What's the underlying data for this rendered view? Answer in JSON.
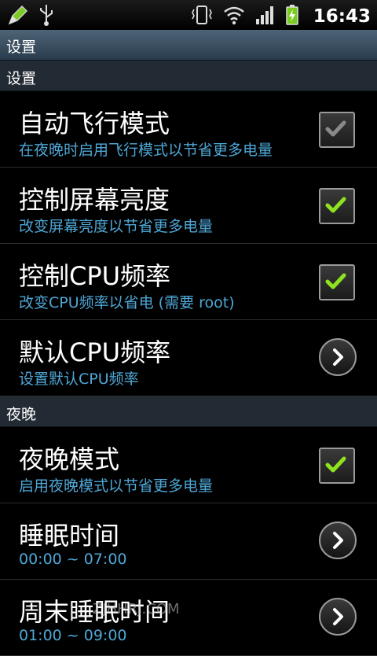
{
  "status_bar": {
    "time": "16:43",
    "icons": [
      "edit-icon",
      "usb-icon",
      "vibrate-icon",
      "wifi-icon",
      "signal-icon",
      "battery-charging-icon"
    ]
  },
  "title_bar": {
    "title": "设置"
  },
  "sections": [
    {
      "header": "设置",
      "items": [
        {
          "title": "自动飞行模式",
          "summary": "在夜晚时启用飞行模式以节省更多电量",
          "control": "checkbox",
          "checked": true,
          "enabled": false
        },
        {
          "title": "控制屏幕亮度",
          "summary": "改变屏幕亮度以节省更多电量",
          "control": "checkbox",
          "checked": true,
          "enabled": true
        },
        {
          "title": "控制CPU频率",
          "summary": "改变CPU频率以省电 (需要 root)",
          "control": "checkbox",
          "checked": true,
          "enabled": true
        },
        {
          "title": "默认CPU频率",
          "summary": "设置默认CPU频率",
          "control": "arrow"
        }
      ]
    },
    {
      "header": "夜晚",
      "items": [
        {
          "title": "夜晚模式",
          "summary": "启用夜晚模式以节省更多电量",
          "control": "checkbox",
          "checked": true,
          "enabled": true
        },
        {
          "title": "睡眠时间",
          "summary": "00:00 ~ 07:00",
          "control": "arrow"
        },
        {
          "title": "周末睡眠时间",
          "summary": "01:00 ~ 09:00",
          "control": "arrow"
        }
      ]
    }
  ],
  "watermark": "ZJHHRJ.COM",
  "colors": {
    "summary_text": "#4ea7d6",
    "check_active": "#8ee21f",
    "check_disabled": "#8a8a8a",
    "title_bar": "#3d5366",
    "section_bg": "#222a33"
  }
}
